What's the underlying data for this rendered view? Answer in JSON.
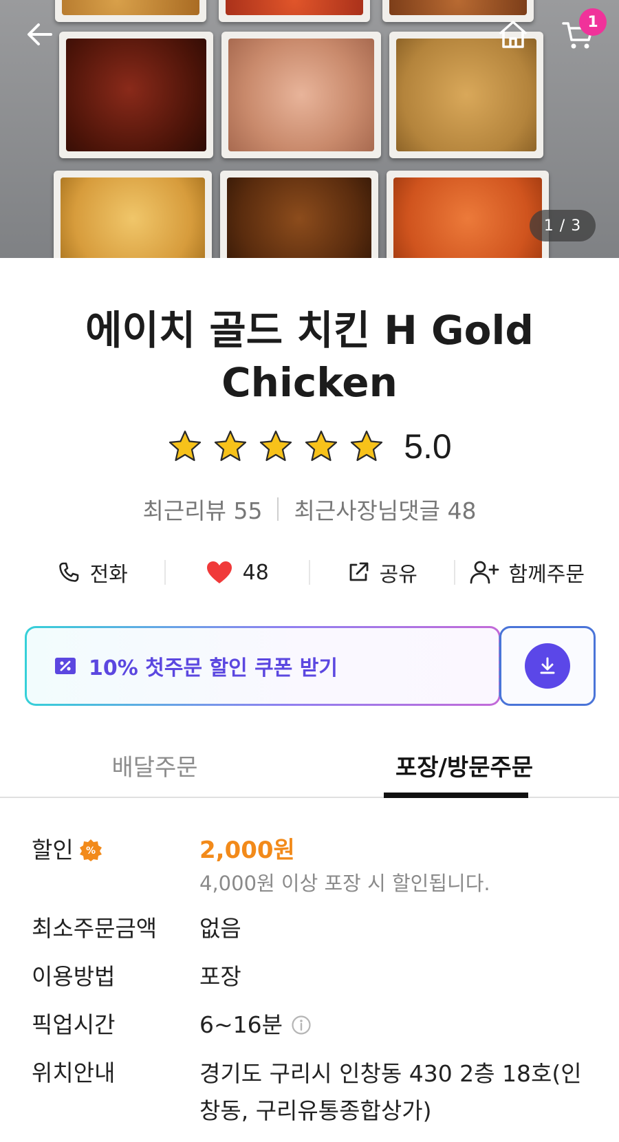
{
  "hero": {
    "image_counter": "1 / 3",
    "cart_count": "1"
  },
  "store": {
    "name": "에이치 골드 치킨 H Gold Chicken",
    "rating": "5.0",
    "rating_stars": 5,
    "recent_reviews": "최근리뷰 55",
    "owner_replies": "최근사장님댓글 48"
  },
  "actions": {
    "call": "전화",
    "likes": "48",
    "share": "공유",
    "group_order": "함께주문"
  },
  "coupon": {
    "label": "10% 첫주문 할인 쿠폰 받기"
  },
  "tabs": {
    "delivery": "배달주문",
    "pickup": "포장/방문주문",
    "active": "pickup"
  },
  "info": {
    "discount_label": "할인",
    "discount_amount": "2,000원",
    "discount_note": "4,000원 이상 포장 시 할인됩니다.",
    "min_order_label": "최소주문금액",
    "min_order_value": "없음",
    "method_label": "이용방법",
    "method_value": "포장",
    "pickup_time_label": "픽업시간",
    "pickup_time_value": "6~16분",
    "location_label": "위치안내",
    "location_value": "경기도 구리시 인창동 430 2층 18호(인창동, 구리유통종합상가)"
  },
  "colors": {
    "accent_purple": "#5b47e8",
    "discount_orange": "#f28a1a",
    "like_red": "#f03a3a",
    "badge_pink": "#f0329a"
  }
}
